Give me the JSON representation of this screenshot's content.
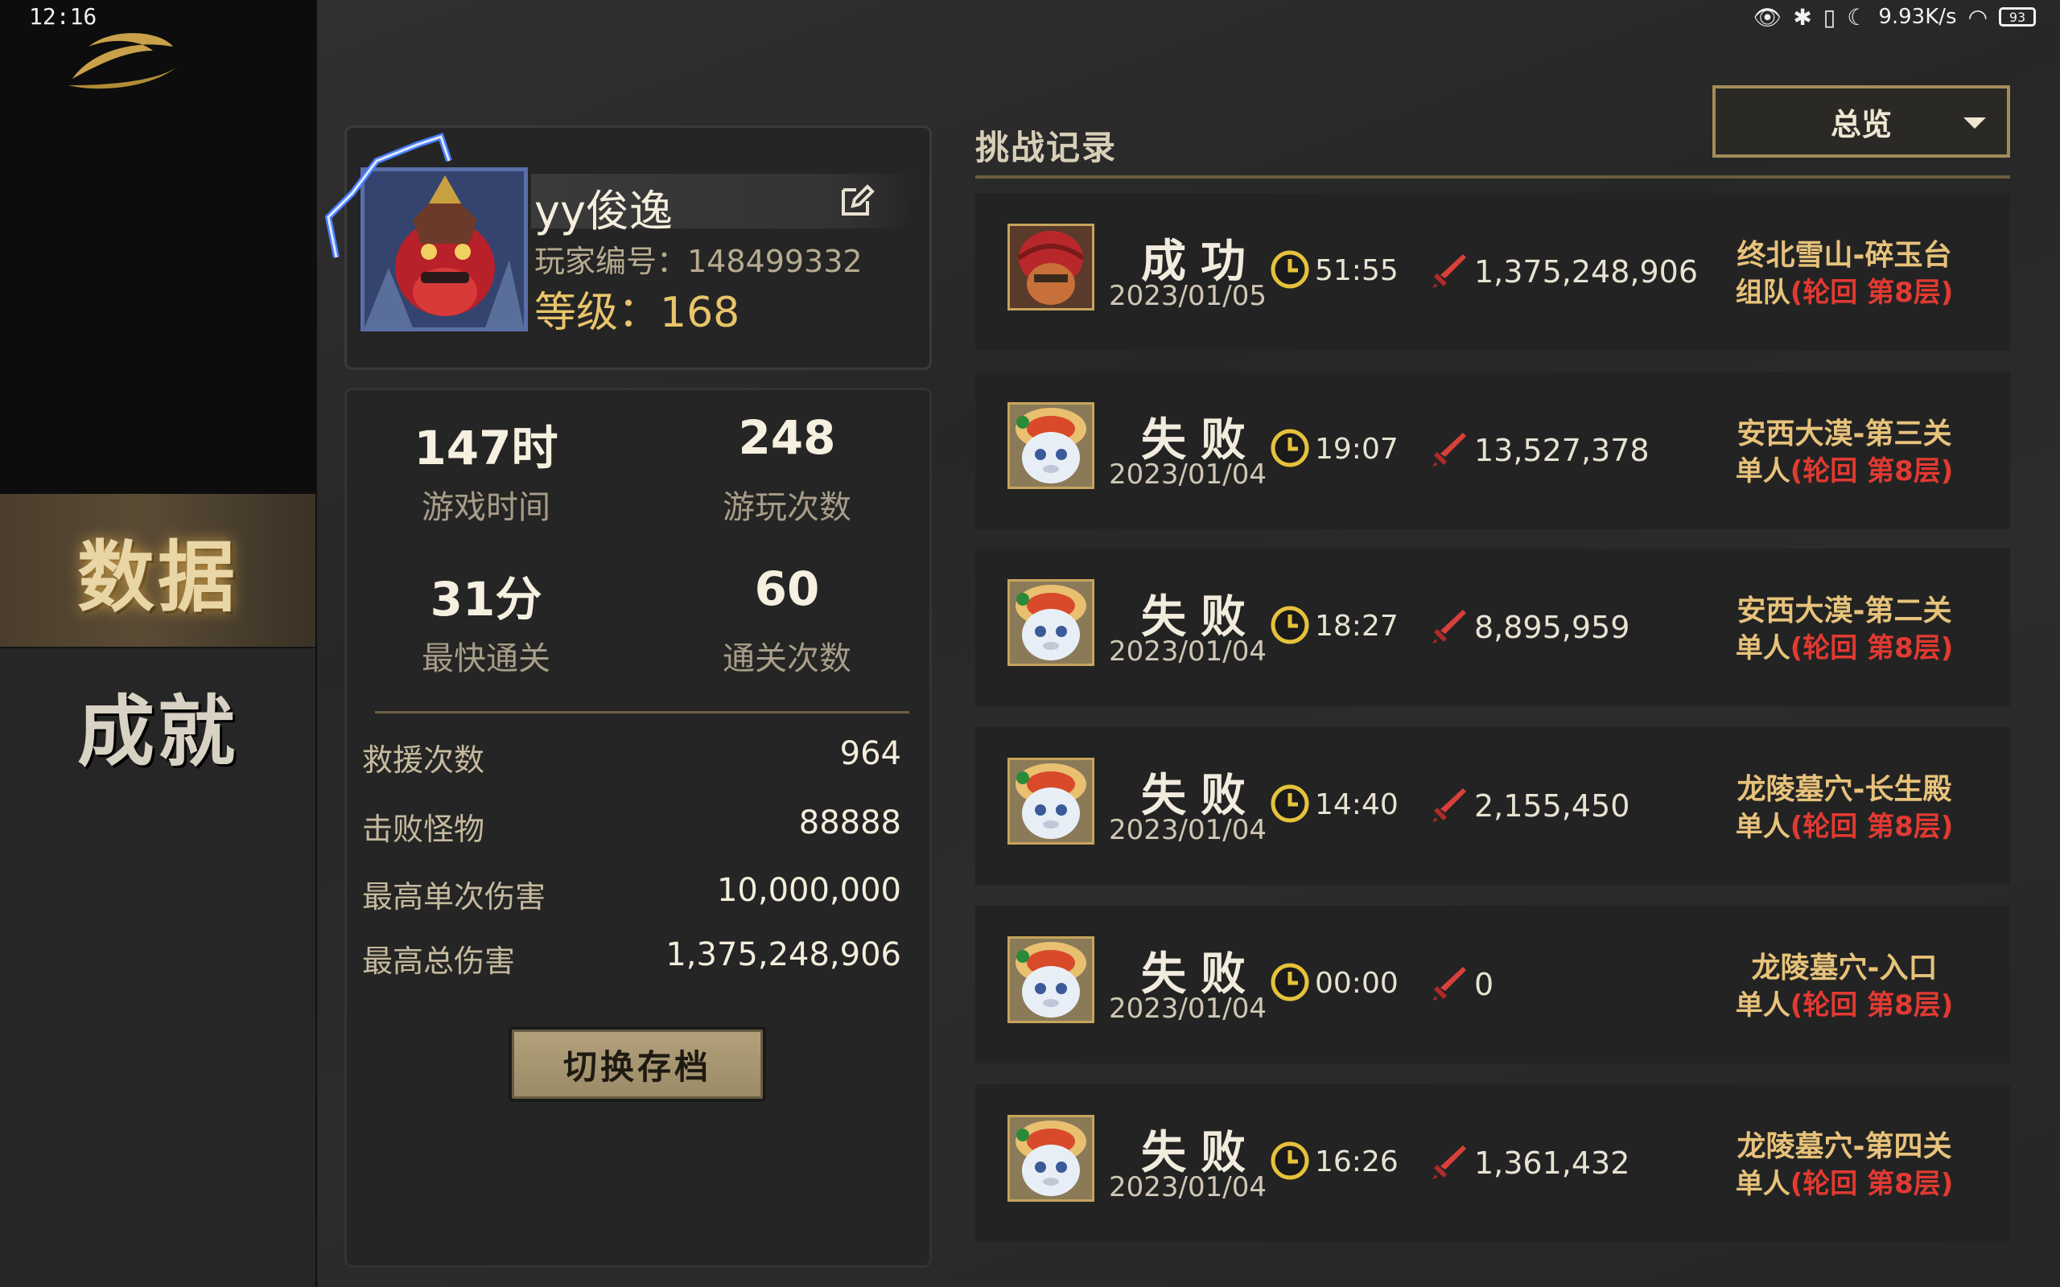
{
  "status_bar": {
    "time": "12:16",
    "net_speed": "9.93K/s",
    "battery": "93"
  },
  "sidebar": {
    "items": [
      {
        "label": "数据",
        "active": true
      },
      {
        "label": "成就",
        "active": false
      }
    ]
  },
  "profile": {
    "name": "yy俊逸",
    "id_label": "玩家编号：148499332",
    "level_label": "等级：168"
  },
  "stats": {
    "grid": [
      {
        "value": "147时",
        "label": "游戏时间"
      },
      {
        "value": "248",
        "label": "游玩次数"
      },
      {
        "value": "31分",
        "label": "最快通关"
      },
      {
        "value": "60",
        "label": "通关次数"
      }
    ],
    "list": [
      {
        "label": "救援次数",
        "value": "964"
      },
      {
        "label": "击败怪物",
        "value": "88888"
      },
      {
        "label": "最高单次伤害",
        "value": "10,000,000"
      },
      {
        "label": "最高总伤害",
        "value": "1,375,248,906"
      }
    ],
    "switch_button": "切换存档"
  },
  "records": {
    "title": "挑战记录",
    "filter": "总览",
    "items": [
      {
        "result": "成功",
        "date": "2023/01/05",
        "time": "51:55",
        "damage": "1,375,248,906",
        "stage": "终北雪山-碎玉台",
        "mode_a": "组队",
        "mode_b": "(轮回 第8层)",
        "avatar": "red-warrior"
      },
      {
        "result": "失败",
        "date": "2023/01/04",
        "time": "19:07",
        "damage": "13,527,378",
        "stage": "安西大漠-第三关",
        "mode_a": "单人",
        "mode_b": "(轮回 第8层)",
        "avatar": "lion-cat"
      },
      {
        "result": "失败",
        "date": "2023/01/04",
        "time": "18:27",
        "damage": "8,895,959",
        "stage": "安西大漠-第二关",
        "mode_a": "单人",
        "mode_b": "(轮回 第8层)",
        "avatar": "lion-cat"
      },
      {
        "result": "失败",
        "date": "2023/01/04",
        "time": "14:40",
        "damage": "2,155,450",
        "stage": "龙陵墓穴-长生殿",
        "mode_a": "单人",
        "mode_b": "(轮回 第8层)",
        "avatar": "lion-cat"
      },
      {
        "result": "失败",
        "date": "2023/01/04",
        "time": "00:00",
        "damage": "0",
        "stage": "龙陵墓穴-入口",
        "mode_a": "单人",
        "mode_b": "(轮回 第8层)",
        "avatar": "lion-cat"
      },
      {
        "result": "失败",
        "date": "2023/01/04",
        "time": "16:26",
        "damage": "1,361,432",
        "stage": "龙陵墓穴-第四关",
        "mode_a": "单人",
        "mode_b": "(轮回 第8层)",
        "avatar": "lion-cat"
      }
    ]
  },
  "colors": {
    "accent_gold": "#e9c56a",
    "mode_red": "#e23a32",
    "stage_gold": "#e7c27a"
  }
}
